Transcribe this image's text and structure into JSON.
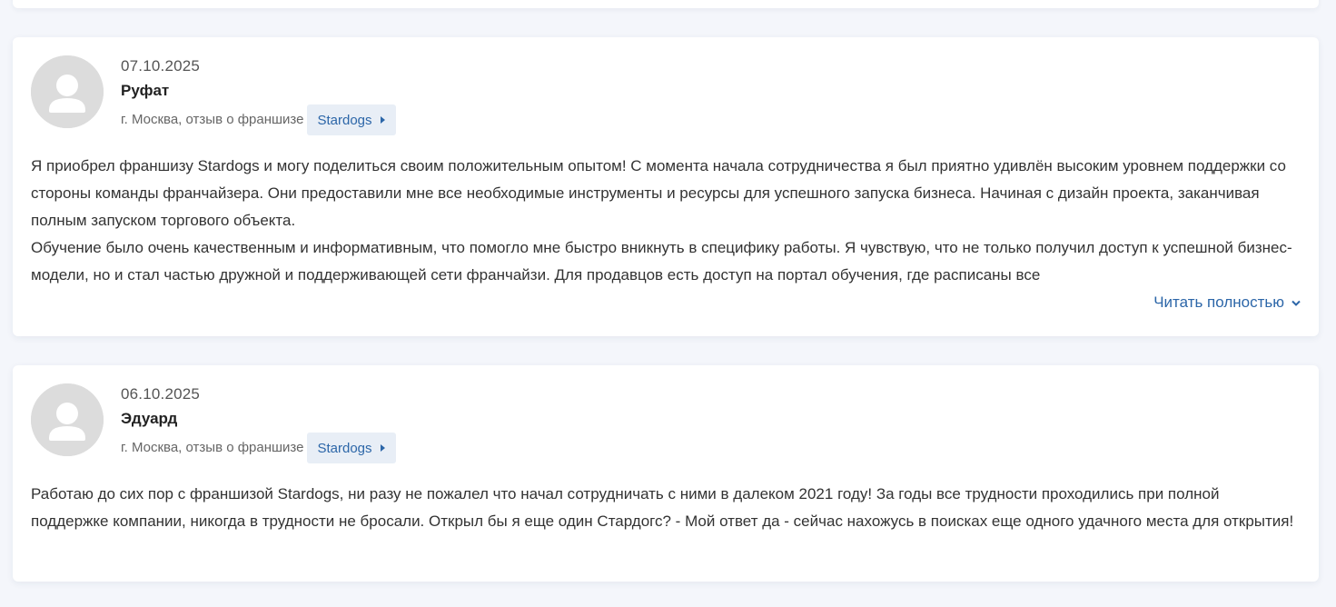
{
  "reviews": [
    {
      "date": "07.10.2025",
      "author": "Руфат",
      "location": "г. Москва, отзыв о франшизе",
      "brand": "Stardogs",
      "paragraphs": [
        "Я приобрел франшизу Stardogs и могу поделиться своим положительным опытом! С момента начала сотрудничества я был приятно удивлён высоким уровнем поддержки со стороны команды франчайзера. Они предоставили мне все необходимые инструменты и ресурсы для успешного запуска бизнеса. Начиная с дизайн проекта, заканчивая полным запуском торгового объекта.",
        "Обучение было очень качественным и информативным, что помогло мне быстро вникнуть в специфику работы. Я чувствую, что не только получил доступ к успешной бизнес-модели, но и стал частью дружной и поддерживающей сети франчайзи. Для продавцов есть доступ на портал обучения, где расписаны все"
      ],
      "read_more": "Читать полностью"
    },
    {
      "date": "06.10.2025",
      "author": "Эдуард",
      "location": "г. Москва, отзыв о франшизе",
      "brand": "Stardogs",
      "paragraphs": [
        "Работаю до сих пор с франшизой Stardogs, ни разу не пожалел что начал сотрудничать с ними в далеком 2021 году! За годы все трудности проходились при полной поддержке компании, никогда в трудности не бросали. Открыл бы я еще один Стардогс? - Мой ответ да - сейчас нахожусь в поисках еще одного удачного места для открытия!"
      ]
    }
  ],
  "icons": {
    "avatar": "user-silhouette-icon",
    "brand_arrow": "triangle-right-icon",
    "read_more": "chevron-down-icon"
  },
  "colors": {
    "link": "#2c66a8",
    "tag_bg": "#e8eef6",
    "page_bg": "#f4f6fb"
  }
}
